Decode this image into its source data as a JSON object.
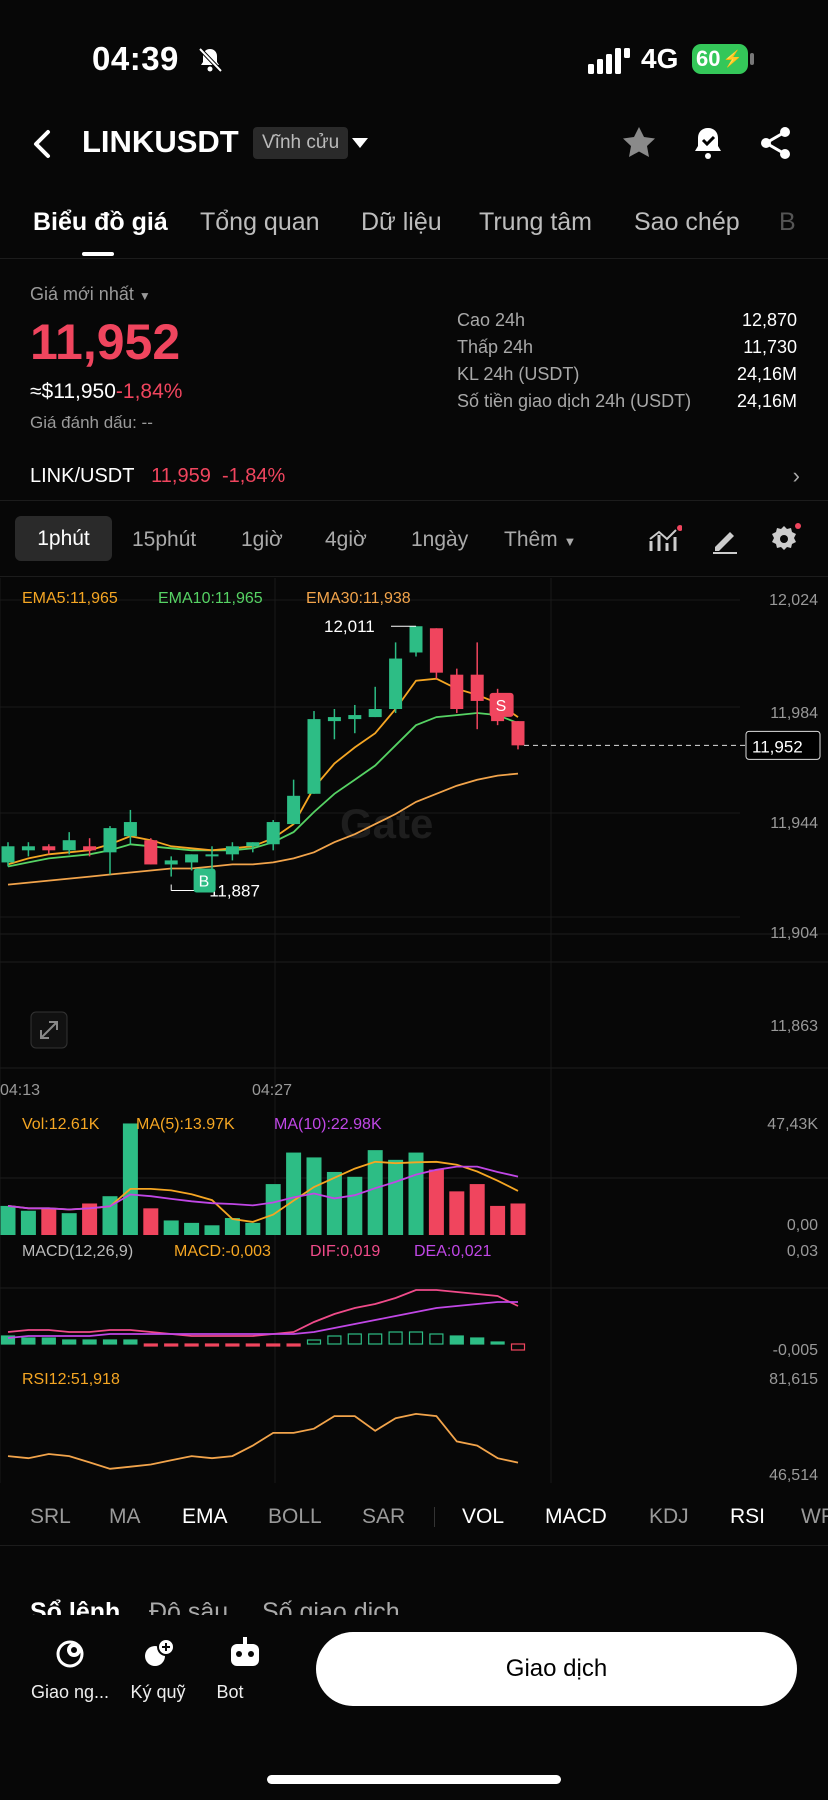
{
  "status": {
    "time": "04:39",
    "network": "4G",
    "battery": "60"
  },
  "header": {
    "pair": "LINKUSDT",
    "tag": "Vĩnh cửu"
  },
  "tabs": [
    "Biểu đồ giá",
    "Tổng quan",
    "Dữ liệu",
    "Trung tâm",
    "Sao chép",
    "B"
  ],
  "price": {
    "label": "Giá mới nhất",
    "last": "11,952",
    "usd": "≈$11,950",
    "change": "-1,84%",
    "mark": "Giá đánh dấu: --"
  },
  "stats": [
    {
      "k": "Cao 24h",
      "v": "12,870"
    },
    {
      "k": "Thấp 24h",
      "v": "11,730"
    },
    {
      "k": "KL 24h (USDT)",
      "v": "24,16M"
    },
    {
      "k": "Số tiền giao dịch 24h (USDT)",
      "v": "24,16M"
    }
  ],
  "spot": {
    "pair": "LINK/USDT",
    "price": "11,959",
    "change": "-1,84%"
  },
  "intervals": [
    "1phút",
    "15phút",
    "1giờ",
    "4giờ",
    "1ngày",
    "Thêm"
  ],
  "chart": {
    "ema_labels": [
      "EMA5:11,965",
      "EMA10:11,965",
      "EMA30:11,938"
    ],
    "y_ticks": [
      "12,024",
      "11,984",
      "11,944",
      "11,904",
      "11,863"
    ],
    "x_ticks": [
      "04:13",
      "04:27"
    ],
    "high_label": "12,011",
    "low_label": "11,887",
    "current": "11,952",
    "buy": "B",
    "sell": "S",
    "watermark": "Gate",
    "vol_labels": [
      "Vol:12.61K",
      "MA(5):13.97K",
      "MA(10):22.98K"
    ],
    "vol_ticks": [
      "47,43K",
      "0,00"
    ],
    "macd_labels": [
      "MACD(12,26,9)",
      "MACD:-0,003",
      "DIF:0,019",
      "DEA:0,021"
    ],
    "macd_ticks": [
      "0,03",
      "-0,005"
    ],
    "rsi_label": "RSI12:51,918",
    "rsi_ticks": [
      "81,615",
      "46,514"
    ],
    "colors": {
      "up": "#2dbd85",
      "down": "#f0455e",
      "ema5": "#f5a623",
      "ema10": "#56d364",
      "ema30": "#f2a44b"
    }
  },
  "chart_data": {
    "type": "candlestick",
    "candles": [
      {
        "o": 11894,
        "h": 11904,
        "l": 11892,
        "c": 11902
      },
      {
        "o": 11900,
        "h": 11904,
        "l": 11897,
        "c": 11902
      },
      {
        "o": 11902,
        "h": 11903,
        "l": 11898,
        "c": 11900
      },
      {
        "o": 11900,
        "h": 11909,
        "l": 11898,
        "c": 11905
      },
      {
        "o": 11902,
        "h": 11906,
        "l": 11897,
        "c": 11900
      },
      {
        "o": 11899,
        "h": 11912,
        "l": 11888,
        "c": 11911
      },
      {
        "o": 11907,
        "h": 11920,
        "l": 11903,
        "c": 11914
      },
      {
        "o": 11905,
        "h": 11906,
        "l": 11893,
        "c": 11893
      },
      {
        "o": 11893,
        "h": 11897,
        "l": 11887,
        "c": 11895
      },
      {
        "o": 11894,
        "h": 11898,
        "l": 11890,
        "c": 11898
      },
      {
        "o": 11897,
        "h": 11902,
        "l": 11891,
        "c": 11898
      },
      {
        "o": 11898,
        "h": 11904,
        "l": 11895,
        "c": 11902
      },
      {
        "o": 11902,
        "h": 11904,
        "l": 11899,
        "c": 11904
      },
      {
        "o": 11903,
        "h": 11915,
        "l": 11900,
        "c": 11914
      },
      {
        "o": 11913,
        "h": 11935,
        "l": 11913,
        "c": 11927
      },
      {
        "o": 11928,
        "h": 11969,
        "l": 11928,
        "c": 11965
      },
      {
        "o": 11964,
        "h": 11970,
        "l": 11955,
        "c": 11966
      },
      {
        "o": 11965,
        "h": 11972,
        "l": 11958,
        "c": 11967
      },
      {
        "o": 11966,
        "h": 11981,
        "l": 11966,
        "c": 11970
      },
      {
        "o": 11970,
        "h": 12003,
        "l": 11968,
        "c": 11995
      },
      {
        "o": 11998,
        "h": 12011,
        "l": 11996,
        "c": 12011
      },
      {
        "o": 12010,
        "h": 12010,
        "l": 11985,
        "c": 11988
      },
      {
        "o": 11987,
        "h": 11990,
        "l": 11968,
        "c": 11970
      },
      {
        "o": 11987,
        "h": 12003,
        "l": 11960,
        "c": 11974
      },
      {
        "o": 11974,
        "h": 11980,
        "l": 11962,
        "c": 11964
      },
      {
        "o": 11964,
        "h": 11964,
        "l": 11950,
        "c": 11952
      }
    ],
    "ema5": [
      11893,
      11896,
      11898,
      11899,
      11900,
      11903,
      11907,
      11905,
      11902,
      11901,
      11900,
      11901,
      11902,
      11906,
      11913,
      11931,
      11943,
      11951,
      11958,
      11970,
      11984,
      11985,
      11980,
      11977,
      11973,
      11966
    ],
    "ema10": [
      11892,
      11894,
      11896,
      11897,
      11898,
      11900,
      11903,
      11902,
      11901,
      11900,
      11900,
      11900,
      11901,
      11904,
      11909,
      11919,
      11928,
      11935,
      11942,
      11952,
      11962,
      11966,
      11967,
      11968,
      11967,
      11963
    ],
    "ema30": [
      11883,
      11884,
      11885,
      11886,
      11887,
      11888,
      11889,
      11890,
      11891,
      11891,
      11892,
      11893,
      11893,
      11894,
      11896,
      11899,
      11904,
      11908,
      11913,
      11918,
      11924,
      11928,
      11932,
      11935,
      11937,
      11938
    ],
    "volume": [
      12,
      10,
      11,
      9,
      13,
      16,
      46,
      11,
      6,
      5,
      4,
      7,
      5,
      21,
      34,
      32,
      26,
      24,
      35,
      31,
      34,
      27,
      18,
      21,
      12,
      13
    ],
    "macd_hist": [
      0.004,
      0.003,
      0.003,
      0.002,
      0.002,
      0.002,
      0.002,
      -0.001,
      -0.001,
      -0.001,
      -0.001,
      -0.001,
      -0.001,
      -0.001,
      -0.001,
      0.002,
      0.004,
      0.005,
      0.005,
      0.006,
      0.006,
      0.005,
      0.004,
      0.003,
      0.001,
      -0.003
    ],
    "dif": [
      0.006,
      0.007,
      0.007,
      0.006,
      0.006,
      0.007,
      0.007,
      0.006,
      0.005,
      0.004,
      0.004,
      0.004,
      0.004,
      0.005,
      0.006,
      0.011,
      0.015,
      0.018,
      0.02,
      0.023,
      0.027,
      0.027,
      0.026,
      0.025,
      0.024,
      0.019
    ],
    "dea": [
      0.003,
      0.004,
      0.004,
      0.004,
      0.004,
      0.005,
      0.005,
      0.005,
      0.005,
      0.005,
      0.005,
      0.005,
      0.005,
      0.005,
      0.005,
      0.006,
      0.008,
      0.01,
      0.012,
      0.014,
      0.016,
      0.018,
      0.019,
      0.02,
      0.021,
      0.021
    ],
    "rsi": [
      55,
      54,
      56,
      55,
      52,
      49,
      50,
      51,
      53,
      55,
      54,
      55,
      60,
      66,
      66,
      68,
      74,
      74,
      67,
      73,
      75,
      74,
      62,
      60,
      54,
      51.9
    ],
    "y_range": [
      11863,
      12024
    ],
    "vol_range": [
      0,
      47.43
    ],
    "rsi_range": [
      46.514,
      81.615
    ]
  },
  "indicators": [
    "SRL",
    "MA",
    "EMA",
    "BOLL",
    "SAR",
    "VOL",
    "MACD",
    "KDJ",
    "RSI",
    "WR"
  ],
  "orderbook_tabs": [
    "Sổ lệnh",
    "Độ sâu",
    "Số giao dịch"
  ],
  "dock": {
    "items": [
      "Giao ng...",
      "Ký quỹ",
      "Bot"
    ],
    "trade": "Giao dịch"
  }
}
